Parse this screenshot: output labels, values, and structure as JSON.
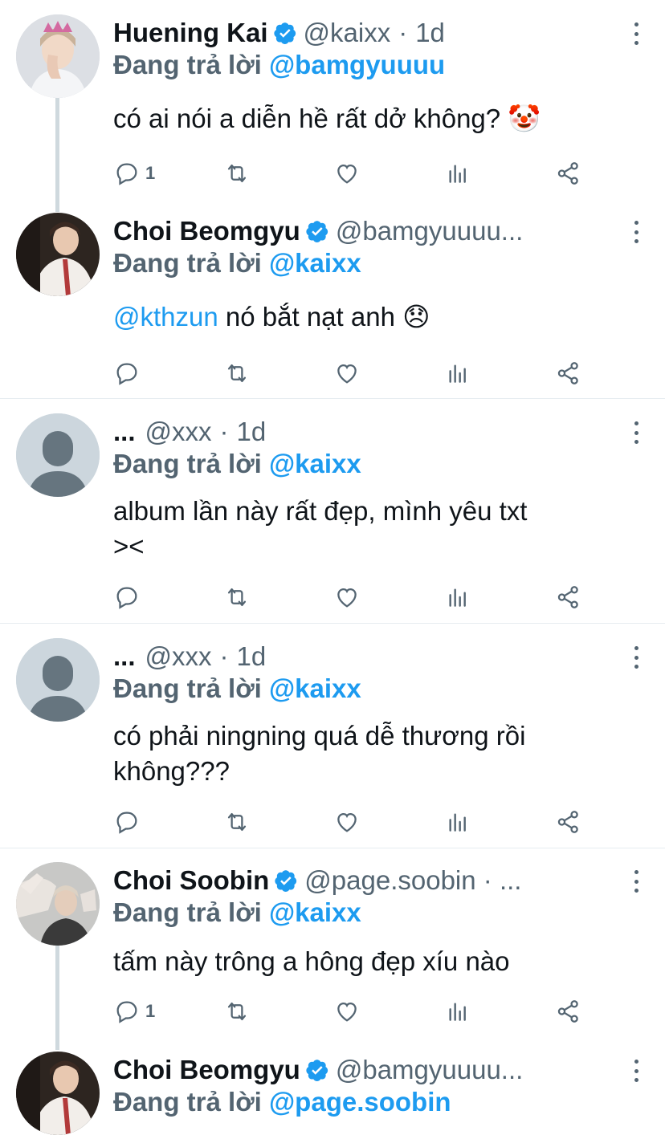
{
  "colors": {
    "accent": "#1d9bf0",
    "secondary": "#536471",
    "text": "#0f1419",
    "divider": "#e6ecf0",
    "thread_line": "#cfd9de"
  },
  "reply_prefix": "Đang trả lời",
  "tweets": [
    {
      "name": "Huening Kai",
      "verified": true,
      "handle": "@kaixx",
      "sep": "·",
      "time": "1d",
      "reply_to": "@bamgyuuuu",
      "text": "có ai nói a diễn hề rất dở không?",
      "emoji": "🤡",
      "reply_count": "1",
      "avatar_icon": "profile-photo"
    },
    {
      "name": "Choi Beomgyu",
      "verified": true,
      "handle": "@bamgyuuuu...",
      "reply_to": "@kaixx",
      "mention": "@kthzun",
      "text": "nó bắt nạt anh",
      "emoji": "😞",
      "reply_count": "",
      "avatar_icon": "profile-photo"
    },
    {
      "name": "...",
      "verified": false,
      "handle": "@xxx",
      "sep": "·",
      "time": "1d",
      "reply_to": "@kaixx",
      "text_lines": [
        "album lần này rất đẹp, mình yêu txt",
        "><"
      ],
      "reply_count": "",
      "avatar_icon": "default-avatar"
    },
    {
      "name": "...",
      "verified": false,
      "handle": "@xxx",
      "sep": "·",
      "time": "1d",
      "reply_to": "@kaixx",
      "text_lines": [
        "có phải ningning quá dễ thương rồi",
        "không???"
      ],
      "reply_count": "",
      "avatar_icon": "default-avatar"
    },
    {
      "name": "Choi Soobin",
      "verified": true,
      "handle": "@page.soobin · ...",
      "reply_to": "@kaixx",
      "text": "tấm này trông a hông đẹp xíu nào",
      "reply_count": "1",
      "avatar_icon": "profile-photo"
    },
    {
      "name": "Choi Beomgyu",
      "verified": true,
      "handle": "@bamgyuuuu...",
      "reply_to": "@page.soobin",
      "avatar_icon": "profile-photo"
    }
  ]
}
